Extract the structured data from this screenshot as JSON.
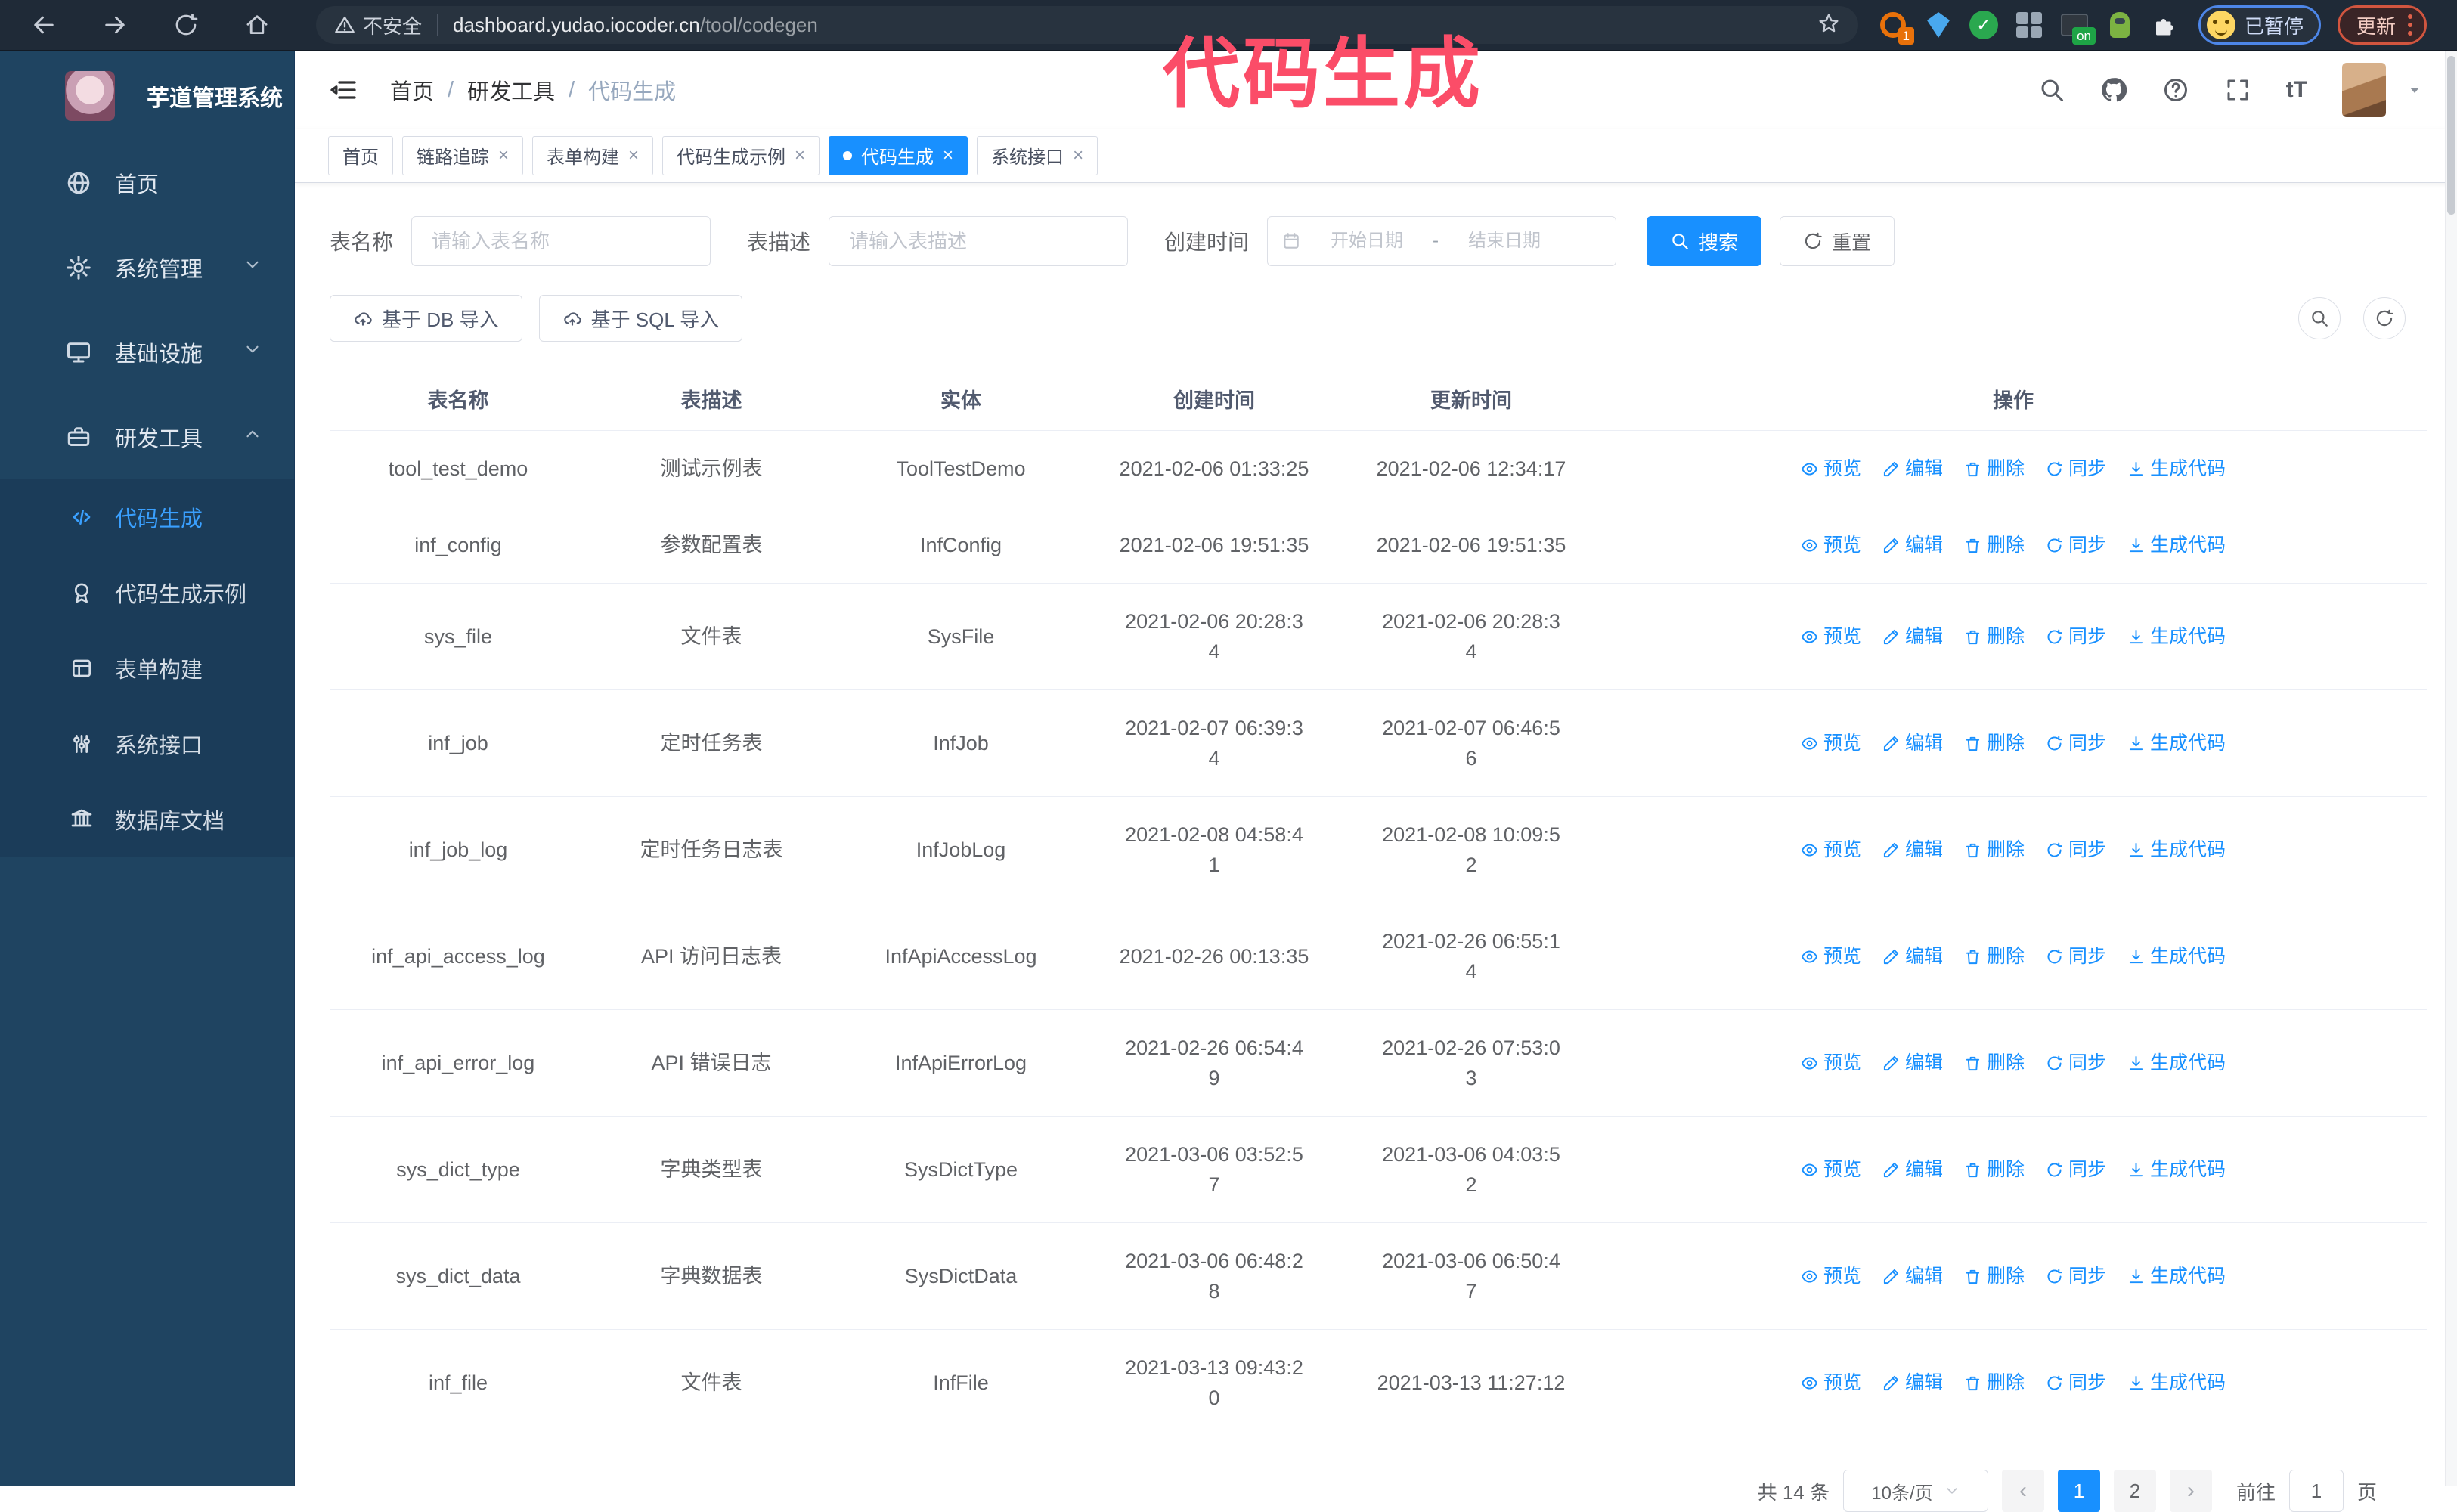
{
  "browser": {
    "security_label": "不安全",
    "url_domain": "dashboard.yudao.iocoder.cn",
    "url_path": "/tool/codegen",
    "extension_badge_count": "1",
    "extension_badge_on": "on",
    "profile_chip_label": "已暂停",
    "update_button_label": "更新"
  },
  "watermark": {
    "text": "代码生成",
    "color": "#fb4d68"
  },
  "sidebar": {
    "app_title": "芋道管理系统",
    "items": [
      {
        "label": "首页"
      },
      {
        "label": "系统管理"
      },
      {
        "label": "基础设施"
      },
      {
        "label": "研发工具"
      }
    ],
    "sub_items": [
      {
        "label": "代码生成",
        "active": true
      },
      {
        "label": "代码生成示例"
      },
      {
        "label": "表单构建"
      },
      {
        "label": "系统接口"
      },
      {
        "label": "数据库文档"
      }
    ]
  },
  "breadcrumb": {
    "items": [
      "首页",
      "研发工具",
      "代码生成"
    ],
    "separator": "/"
  },
  "tabs": [
    {
      "label": "首页",
      "closable": false,
      "active": false
    },
    {
      "label": "链路追踪",
      "closable": true,
      "active": false
    },
    {
      "label": "表单构建",
      "closable": true,
      "active": false
    },
    {
      "label": "代码生成示例",
      "closable": true,
      "active": false
    },
    {
      "label": "代码生成",
      "closable": true,
      "active": true
    },
    {
      "label": "系统接口",
      "closable": true,
      "active": false
    }
  ],
  "filters": {
    "name_label": "表名称",
    "name_placeholder": "请输入表名称",
    "desc_label": "表描述",
    "desc_placeholder": "请输入表描述",
    "time_label": "创建时间",
    "start_placeholder": "开始日期",
    "range_separator": "-",
    "end_placeholder": "结束日期",
    "search_label": "搜索",
    "reset_label": "重置"
  },
  "toolbar": {
    "import_db_label": "基于 DB 导入",
    "import_sql_label": "基于 SQL 导入"
  },
  "table": {
    "columns": [
      "表名称",
      "表描述",
      "实体",
      "创建时间",
      "更新时间",
      "操作"
    ],
    "action_labels": [
      "预览",
      "编辑",
      "删除",
      "同步",
      "生成代码"
    ],
    "rows": [
      {
        "name": "tool_test_demo",
        "desc": "测试示例表",
        "entity": "ToolTestDemo",
        "created": "2021-02-06 01:33:25",
        "updated": "2021-02-06 12:34:17"
      },
      {
        "name": "inf_config",
        "desc": "参数配置表",
        "entity": "InfConfig",
        "created": "2021-02-06 19:51:35",
        "updated": "2021-02-06 19:51:35"
      },
      {
        "name": "sys_file",
        "desc": "文件表",
        "entity": "SysFile",
        "created": "2021-02-06 20:28:34",
        "updated": "2021-02-06 20:28:34"
      },
      {
        "name": "inf_job",
        "desc": "定时任务表",
        "entity": "InfJob",
        "created": "2021-02-07 06:39:34",
        "updated": "2021-02-07 06:46:56"
      },
      {
        "name": "inf_job_log",
        "desc": "定时任务日志表",
        "entity": "InfJobLog",
        "created": "2021-02-08 04:58:41",
        "updated": "2021-02-08 10:09:52"
      },
      {
        "name": "inf_api_access_log",
        "desc": "API 访问日志表",
        "entity": "InfApiAccessLog",
        "created": "2021-02-26 00:13:35",
        "updated": "2021-02-26 06:55:14"
      },
      {
        "name": "inf_api_error_log",
        "desc": "API 错误日志",
        "entity": "InfApiErrorLog",
        "created": "2021-02-26 06:54:49",
        "updated": "2021-02-26 07:53:03"
      },
      {
        "name": "sys_dict_type",
        "desc": "字典类型表",
        "entity": "SysDictType",
        "created": "2021-03-06 03:52:57",
        "updated": "2021-03-06 04:03:52"
      },
      {
        "name": "sys_dict_data",
        "desc": "字典数据表",
        "entity": "SysDictData",
        "created": "2021-03-06 06:48:28",
        "updated": "2021-03-06 06:50:47"
      },
      {
        "name": "inf_file",
        "desc": "文件表",
        "entity": "InfFile",
        "created": "2021-03-13 09:43:20",
        "updated": "2021-03-13 11:27:12"
      }
    ]
  },
  "pagination": {
    "total_label": "共 14 条",
    "page_size_label": "10条/页",
    "pages": [
      "1",
      "2"
    ],
    "active_page": "1",
    "goto_label": "前往",
    "goto_value": "1",
    "page_unit": "页"
  },
  "icons": {
    "browser": [
      "back-icon",
      "forward-icon",
      "reload-icon",
      "home-icon",
      "warning-icon",
      "bookmark-star-icon",
      "extensions-puzzle-icon"
    ],
    "appbar": [
      "collapse-menu-icon",
      "search-icon",
      "github-icon",
      "help-icon",
      "fullscreen-icon",
      "font-size-icon",
      "caret-down-icon"
    ],
    "sidebar": [
      "dashboard-icon",
      "gear-icon",
      "monitor-icon",
      "toolbox-icon",
      "code-icon",
      "badge-icon",
      "form-icon",
      "sliders-icon",
      "database-icon"
    ],
    "actions": [
      "eye-icon",
      "edit-icon",
      "delete-icon",
      "sync-icon",
      "download-icon"
    ],
    "misc": [
      "calendar-icon",
      "cloud-upload-icon",
      "refresh-icon",
      "magnifier-icon"
    ]
  },
  "colors": {
    "accent": "#1890ff",
    "sidebar_bg": "#1f4461",
    "submenu_bg": "#1b3c59",
    "chrome_bg": "#1f2a37",
    "watermark": "#fb4d68"
  }
}
